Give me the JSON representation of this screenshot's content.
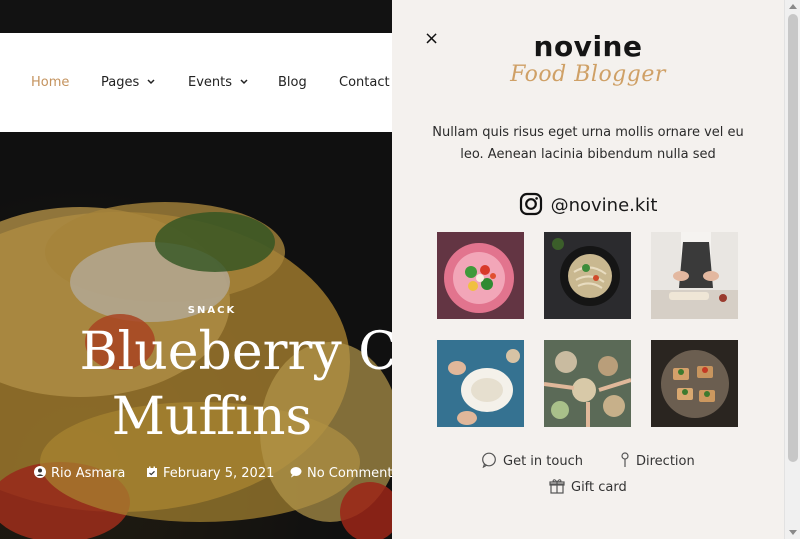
{
  "nav": {
    "items": [
      {
        "label": "Home",
        "active": true,
        "dropdown": false
      },
      {
        "label": "Pages",
        "active": false,
        "dropdown": true
      },
      {
        "label": "Events",
        "active": false,
        "dropdown": true
      },
      {
        "label": "Blog",
        "active": false,
        "dropdown": false
      },
      {
        "label": "Contact",
        "active": false,
        "dropdown": false
      }
    ],
    "caret": "⌄"
  },
  "hero": {
    "category": "SNACK",
    "title_line1": "Blueberry Cheese",
    "title_line2": "Muffins",
    "author": "Rio Asmara",
    "date": "February 5, 2021",
    "comments": "No Comments"
  },
  "panel": {
    "close": "×",
    "logo_main": "novine",
    "logo_sub": "Food Blogger",
    "description": "Nullam quis risus eget urna mollis ornare vel eu leo. Aenean lacinia bibendum nulla sed",
    "instagram_handle": "@novine.kit",
    "instagram_icon": "instagram-icon",
    "gallery": [
      "salad-photo",
      "noodle-bowl-photo",
      "chef-kitchen-photo",
      "flour-dough-photo",
      "shared-table-photo",
      "bruschetta-plate-photo"
    ],
    "links": {
      "get_in_touch": "Get in touch",
      "direction": "Direction",
      "gift_card": "Gift card"
    }
  },
  "colors": {
    "accent": "#c4935e",
    "panel_bg": "#f4f1ee"
  }
}
